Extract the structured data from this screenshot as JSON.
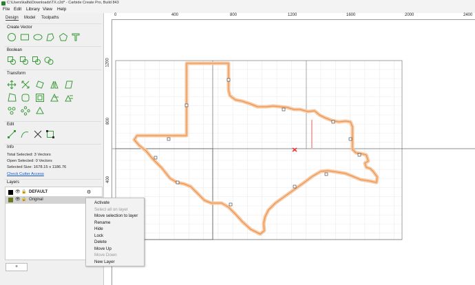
{
  "window": {
    "title": "C:\\Users\\kalfa\\Downloads\\TX.c2d* - Carbide Create Pro, Build 843"
  },
  "menubar": {
    "items": [
      "File",
      "Edit",
      "Library",
      "View",
      "Help"
    ]
  },
  "tabs": [
    "Design",
    "Model",
    "Toolpaths"
  ],
  "sections": {
    "create_vector": "Create Vector",
    "boolean": "Boolean",
    "transform": "Transform",
    "edit": "Edit",
    "info": "Info",
    "layers": "Layers"
  },
  "info": {
    "total_selected": "Total Selected:  3 Vectors",
    "open_selected": "Open Selected:  0 Vectors",
    "selected_size": "Selected Size:  1678.15 x 1186.76",
    "check_cutter": "Check Cutter Access"
  },
  "layers": [
    {
      "name": "DEFAULT",
      "color": "#000000"
    },
    {
      "name": "Original",
      "color": "#6b7a1f"
    }
  ],
  "add_layer_label": "+",
  "rulers": {
    "top": [
      "0",
      "400",
      "800",
      "1200",
      "1600",
      "2000",
      "2400"
    ],
    "left": [
      "1200",
      "800",
      "400"
    ]
  },
  "context_menu": {
    "items": [
      {
        "label": "Activate",
        "enabled": true
      },
      {
        "label": "Select all on layer",
        "enabled": false
      },
      {
        "label": "Move selection to layer",
        "enabled": true
      },
      {
        "label": "Rename",
        "enabled": true
      },
      {
        "label": "Hide",
        "enabled": true
      },
      {
        "label": "Lock",
        "enabled": true
      },
      {
        "label": "Delete",
        "enabled": true
      },
      {
        "label": "Move Up",
        "enabled": true
      },
      {
        "label": "Move Down",
        "enabled": false
      },
      {
        "label": "New Layer",
        "enabled": true
      }
    ]
  },
  "colors": {
    "accent": "#3a9a3a",
    "shape": "#ef8a3a",
    "selected_outline": "#f5c9a5"
  }
}
